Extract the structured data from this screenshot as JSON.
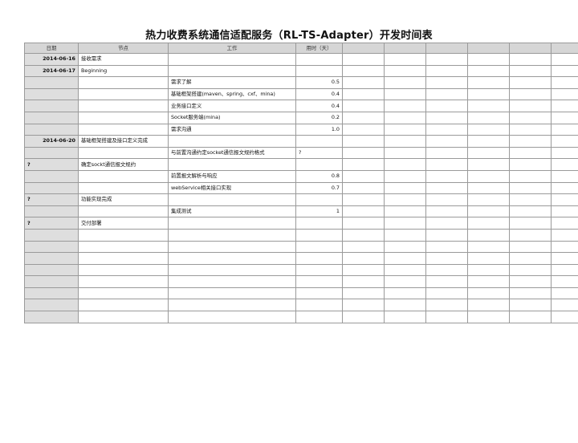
{
  "title": "热力收费系统通信适配服务（RL-TS-Adapter）开发时间表",
  "headers": [
    "日期",
    "节点",
    "工作",
    "用时（天）",
    "",
    "",
    "",
    "",
    "",
    ""
  ],
  "rows": [
    {
      "date": "2014-06-16",
      "node": "接收需求",
      "work": "",
      "hours": ""
    },
    {
      "date": "2014-06-17",
      "node": "Beginning",
      "work": "",
      "hours": ""
    },
    {
      "date": "",
      "node": "",
      "work": "需求了解",
      "hours": "0.5"
    },
    {
      "date": "",
      "node": "",
      "work": "基础框架搭建(maven、spring、cxf、mina)",
      "hours": "0.4"
    },
    {
      "date": "",
      "node": "",
      "work": "业务接口定义",
      "hours": "0.4"
    },
    {
      "date": "",
      "node": "",
      "work": "Socket服务端(mina)",
      "hours": "0.2"
    },
    {
      "date": "",
      "node": "",
      "work": "需求沟通",
      "hours": "1.0"
    },
    {
      "date": "2014-06-20",
      "node": "基础框架搭建及接口定义完成",
      "work": "",
      "hours": ""
    },
    {
      "date": "",
      "node": "",
      "work": "与前置沟通约定socket通信报文规约格式",
      "hours": "?"
    },
    {
      "date": "?",
      "node": "确定sockt通信报文规约",
      "work": "",
      "hours": ""
    },
    {
      "date": "",
      "node": "",
      "work": "前置报文解析与响应",
      "hours": "0.8"
    },
    {
      "date": "",
      "node": "",
      "work": "webService相关接口实现",
      "hours": "0.7"
    },
    {
      "date": "?",
      "node": "功能实现完成",
      "work": "",
      "hours": ""
    },
    {
      "date": "",
      "node": "",
      "work": "集成测试",
      "hours": "1"
    },
    {
      "date": "?",
      "node": "交付部署",
      "work": "",
      "hours": ""
    },
    {
      "date": "",
      "node": "",
      "work": "",
      "hours": ""
    },
    {
      "date": "",
      "node": "",
      "work": "",
      "hours": ""
    },
    {
      "date": "",
      "node": "",
      "work": "",
      "hours": ""
    },
    {
      "date": "",
      "node": "",
      "work": "",
      "hours": ""
    },
    {
      "date": "",
      "node": "",
      "work": "",
      "hours": ""
    },
    {
      "date": "",
      "node": "",
      "work": "",
      "hours": ""
    },
    {
      "date": "",
      "node": "",
      "work": "",
      "hours": ""
    },
    {
      "date": "",
      "node": "",
      "work": "",
      "hours": ""
    }
  ]
}
